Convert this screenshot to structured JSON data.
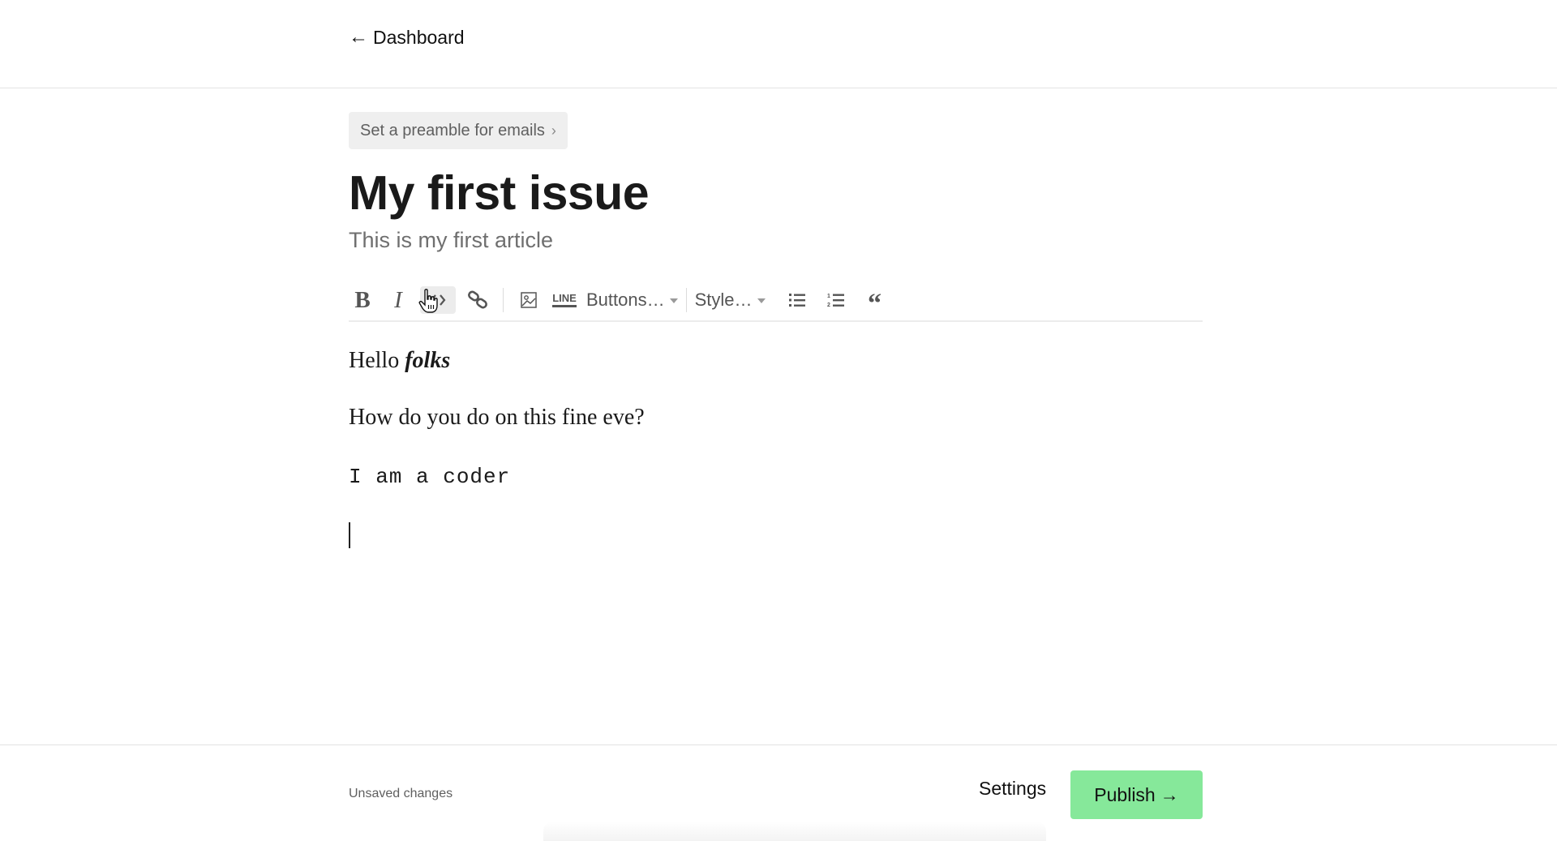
{
  "header": {
    "back_arrow": "←",
    "back_label": "Dashboard"
  },
  "preamble": {
    "label": "Set a preamble for emails",
    "chevron": "›"
  },
  "post": {
    "title": "My first issue",
    "subtitle": "This is my first article"
  },
  "toolbar": {
    "bold": "B",
    "italic": "I",
    "code_icon": "code-icon",
    "link_icon": "link-icon",
    "image_icon": "image-icon",
    "line_label": "LINE",
    "buttons_dropdown": "Buttons…",
    "style_dropdown": "Style…",
    "bullet_list_icon": "bullet-list-icon",
    "numbered_list_icon": "numbered-list-icon",
    "quote_glyph": "“"
  },
  "content": {
    "paragraph_1_plain": "Hello ",
    "paragraph_1_emphasis": "folks",
    "paragraph_2": "How do you do on this fine eve?",
    "paragraph_3_code": "I am a coder"
  },
  "footer": {
    "status": "Unsaved changes",
    "settings_label": "Settings",
    "publish_label": "Publish",
    "publish_arrow": "→"
  },
  "colors": {
    "publish_bg": "#86e89a",
    "preamble_bg": "#efefef",
    "active_tool_bg": "#ececec"
  }
}
